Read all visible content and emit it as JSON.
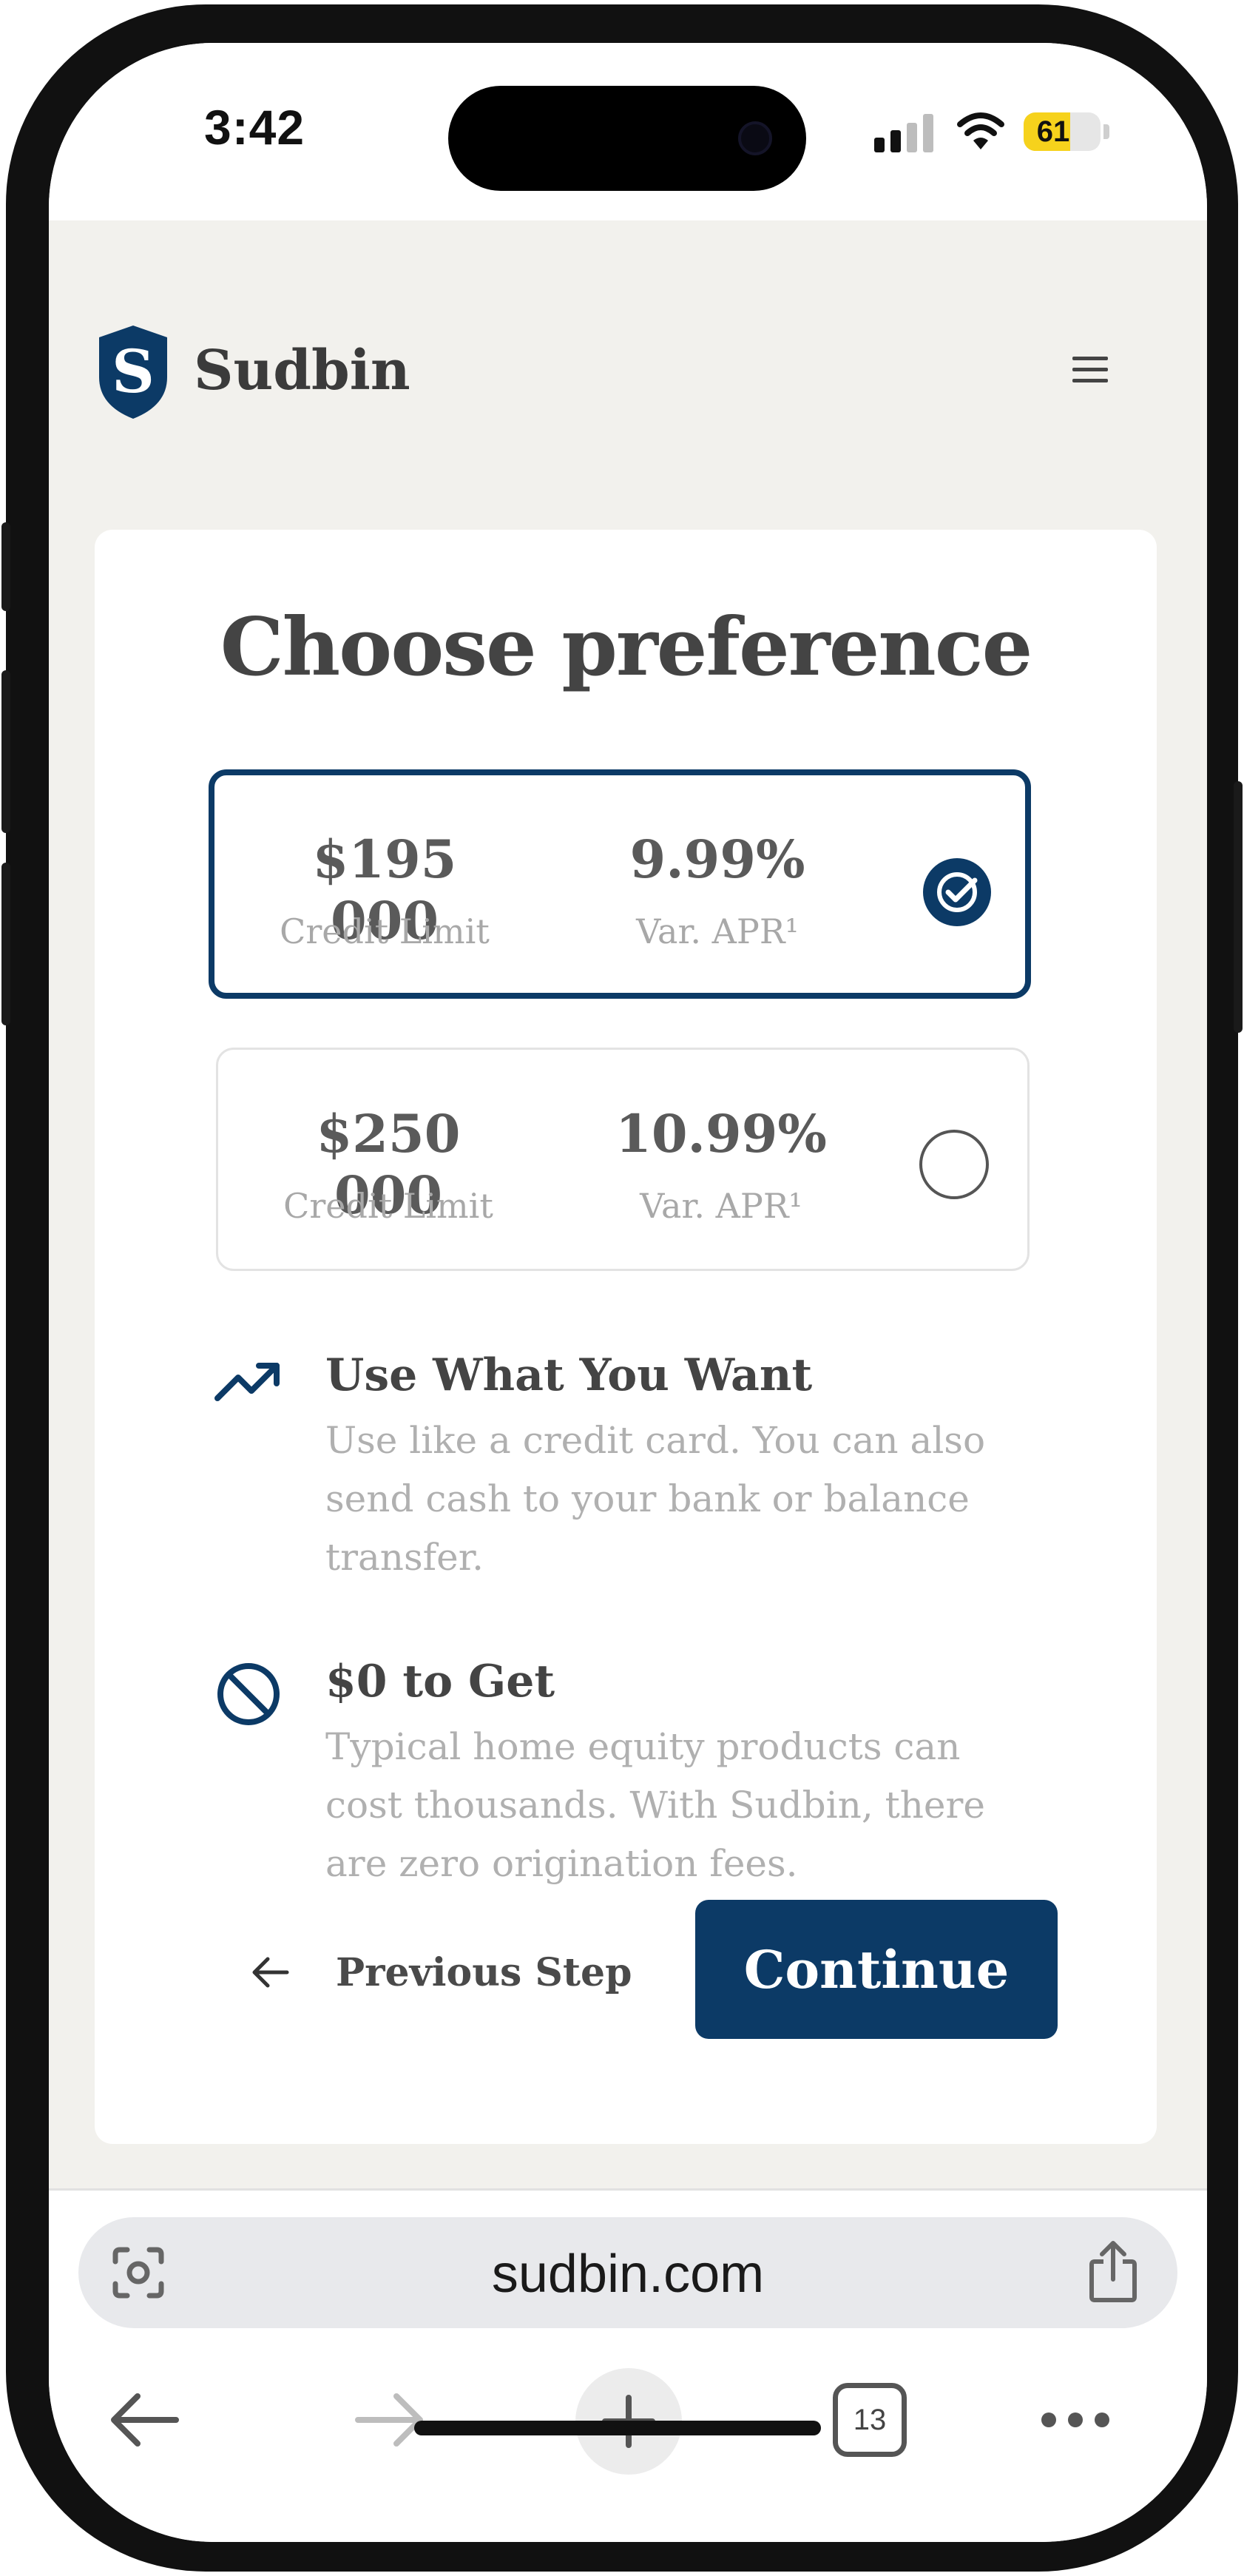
{
  "status_bar": {
    "time": "3:42",
    "battery_level": "61",
    "battery_fraction": 0.61
  },
  "header": {
    "brand_name": "Sudbin",
    "logo_letter": "S"
  },
  "card": {
    "title": "Choose preference",
    "options": [
      {
        "amount": "$195 000",
        "amount_label": "Credit Limit",
        "apr": "9.99%",
        "apr_label": "Var. APR¹",
        "selected": true
      },
      {
        "amount": "$250 000",
        "amount_label": "Credit Limit",
        "apr": "10.99%",
        "apr_label": "Var. APR¹",
        "selected": false
      }
    ],
    "features": [
      {
        "icon": "trending-up-icon",
        "title": "Use What You Want",
        "text": "Use like a credit card. You can also send cash to your bank or balance transfer."
      },
      {
        "icon": "no-fee-icon",
        "title": "$0 to Get",
        "text": "Typical home equity products can cost thousands. With Sudbin, there are zero origination fees."
      }
    ],
    "previous_label": "Previous Step",
    "continue_label": "Continue"
  },
  "browser": {
    "url": "sudbin.com",
    "tab_count": "13"
  },
  "colors": {
    "brand_navy": "#0c3a66",
    "page_background": "#f2f1ed",
    "battery_yellow": "#f6d21c"
  }
}
